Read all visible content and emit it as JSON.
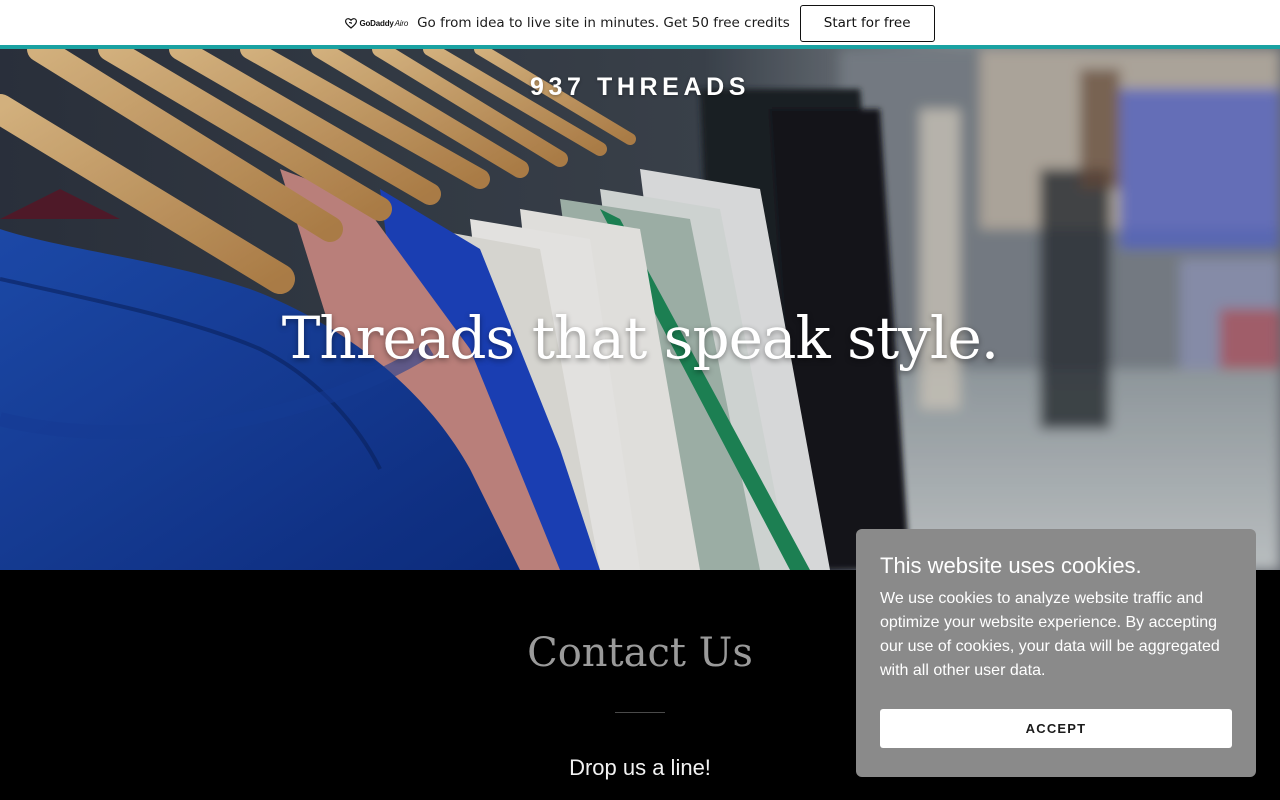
{
  "promo": {
    "logo_brand": "GoDaddy",
    "logo_product": "Airo",
    "logo_icon": "godaddy-heart-icon",
    "message": "Go from idea to live site in minutes. Get 50 free credits",
    "cta_label": "Start for free",
    "accent_color": "#1aa2a2"
  },
  "site": {
    "logo": "937 THREADS"
  },
  "hero": {
    "headline": "Threads that speak style.",
    "background": "clothing-rack-photo"
  },
  "contact": {
    "title": "Contact Us",
    "subtitle": "Drop us a line!"
  },
  "cookie_banner": {
    "title": "This website uses cookies.",
    "body": "We use cookies to analyze website traffic and optimize your website experience. By accepting our use of cookies, your data will be aggregated with all other user data.",
    "accept_label": "ACCEPT",
    "background_color": "#8a8a8a"
  }
}
